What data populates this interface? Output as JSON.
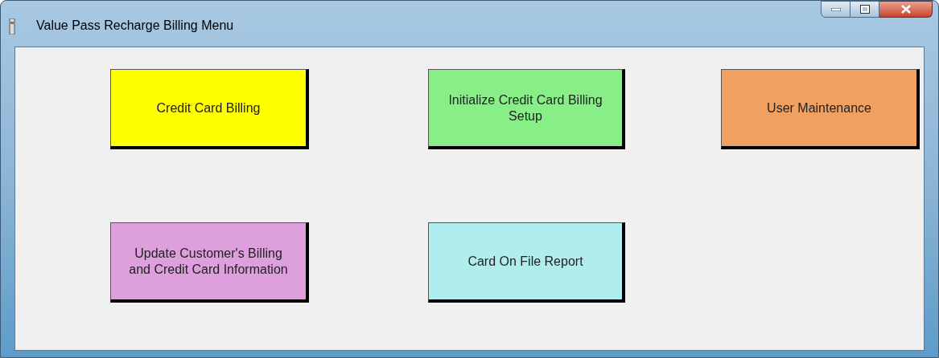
{
  "window": {
    "title": "Value Pass Recharge Billing Menu"
  },
  "rows": [
    [
      {
        "label": "Credit Card Billing",
        "color": "#ffff00"
      },
      {
        "label": "Initialize Credit Card Billing Setup",
        "color": "#88ee88"
      },
      {
        "label": "User Maintenance",
        "color": "#f0a060"
      }
    ],
    [
      {
        "label": "Update Customer's Billing and Credit Card Information",
        "color": "#dda0dd"
      },
      {
        "label": "Card On File Report",
        "color": "#b0eeee"
      }
    ]
  ]
}
